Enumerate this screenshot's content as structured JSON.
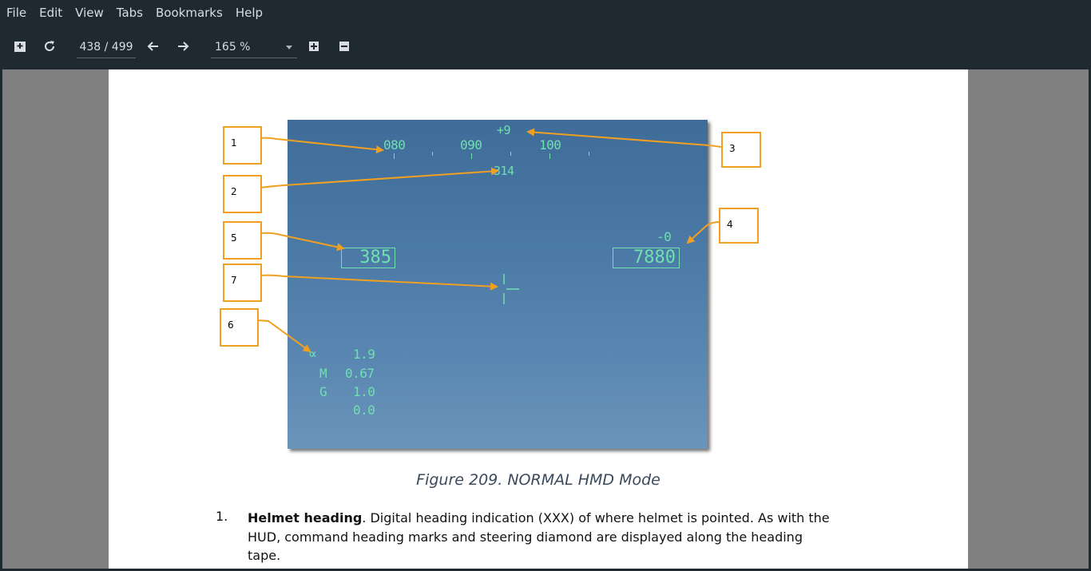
{
  "menu": [
    "File",
    "Edit",
    "View",
    "Tabs",
    "Bookmarks",
    "Help"
  ],
  "toolbar": {
    "page_indicator": "438 / 499",
    "zoom": "165 %"
  },
  "figure": {
    "heading_tape": [
      "080",
      "090",
      "100"
    ],
    "steering_value": "+9",
    "helmet_heading": "314",
    "airspeed": "385",
    "altitude": "7880",
    "vertical_velocity": "-0",
    "alpha_symbol": "∝",
    "alpha_value": "1.9",
    "mach_label": "M",
    "mach_value": "0.67",
    "g_label": "G",
    "g_value": "1.0",
    "extra_value": "0.0",
    "callouts": [
      "1",
      "2",
      "3",
      "4",
      "5",
      "6",
      "7"
    ],
    "callout_color": "#f0a020",
    "symbology_color": "#6fe0b0"
  },
  "caption": "Figure 209. NORMAL HMD Mode",
  "list": {
    "number": "1.",
    "term": "Helmet heading",
    "description": ". Digital heading indication (XXX) of where helmet is pointed. As with the HUD, command heading marks and steering diamond are displayed along the heading tape."
  }
}
